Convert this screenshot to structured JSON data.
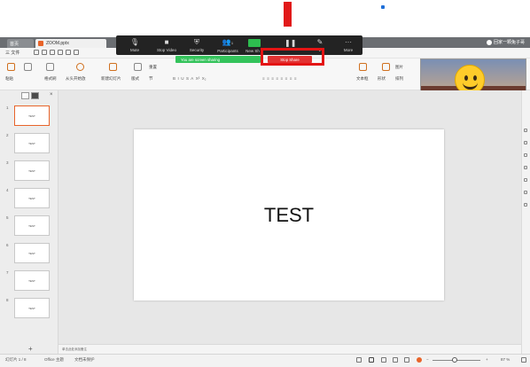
{
  "titlebar": {
    "home_tab": "首页",
    "doc_tab": "ZOOM.pptx",
    "account": "回家一颗兔子哥"
  },
  "menubar": {
    "file_label": "三 文件"
  },
  "ribbon": {
    "paste": "粘贴",
    "format_painter": "格式刷",
    "from_start": "从头开始放",
    "new_slide": "新建幻灯片",
    "layout": "版式",
    "section": "节",
    "reset": "重置",
    "textbox": "文本框",
    "shape": "形状",
    "arrange": "排列",
    "picture": "图片"
  },
  "zoom_toolbar": {
    "mute": "Mute",
    "stop_video": "Stop Video",
    "security": "Security",
    "participants": "Participants",
    "participants_count": "1",
    "new_share": "New Sh",
    "annotate": "e",
    "more": "More",
    "banner_text": "You are screen sharing",
    "stop_share": "Stop Share"
  },
  "panel": {
    "close_glyph": "×"
  },
  "slides": [
    {
      "num": "1",
      "text": "TEST"
    },
    {
      "num": "2",
      "text": "TEST"
    },
    {
      "num": "3",
      "text": "TEST"
    },
    {
      "num": "4",
      "text": "TEST"
    },
    {
      "num": "5",
      "text": "TEST"
    },
    {
      "num": "6",
      "text": "TEST"
    },
    {
      "num": "7",
      "text": "TEST"
    },
    {
      "num": "8",
      "text": "TEST"
    }
  ],
  "current_slide": {
    "text": "TEST"
  },
  "notes_placeholder": "单击此处添加备注",
  "statusbar": {
    "slide_pos": "幻灯片 1 / 8",
    "theme": "Office 主题",
    "protection": "文档未保护",
    "zoom_minus": "−",
    "zoom_plus": "+",
    "zoom_level": "87 %",
    "zoom_fraction": 0.46
  },
  "add_slide_glyph": "+",
  "colors": {
    "zoom_bar": "#232323",
    "sharing_green": "#34c35b",
    "stop_share_red": "#e23232",
    "highlight_red": "#e41414",
    "wps_orange": "#e8642a"
  },
  "icons": [
    "microphone-icon",
    "video-icon",
    "shield-icon",
    "participants-icon",
    "share-screen-icon",
    "pause-icon",
    "annotate-icon",
    "more-icon"
  ]
}
